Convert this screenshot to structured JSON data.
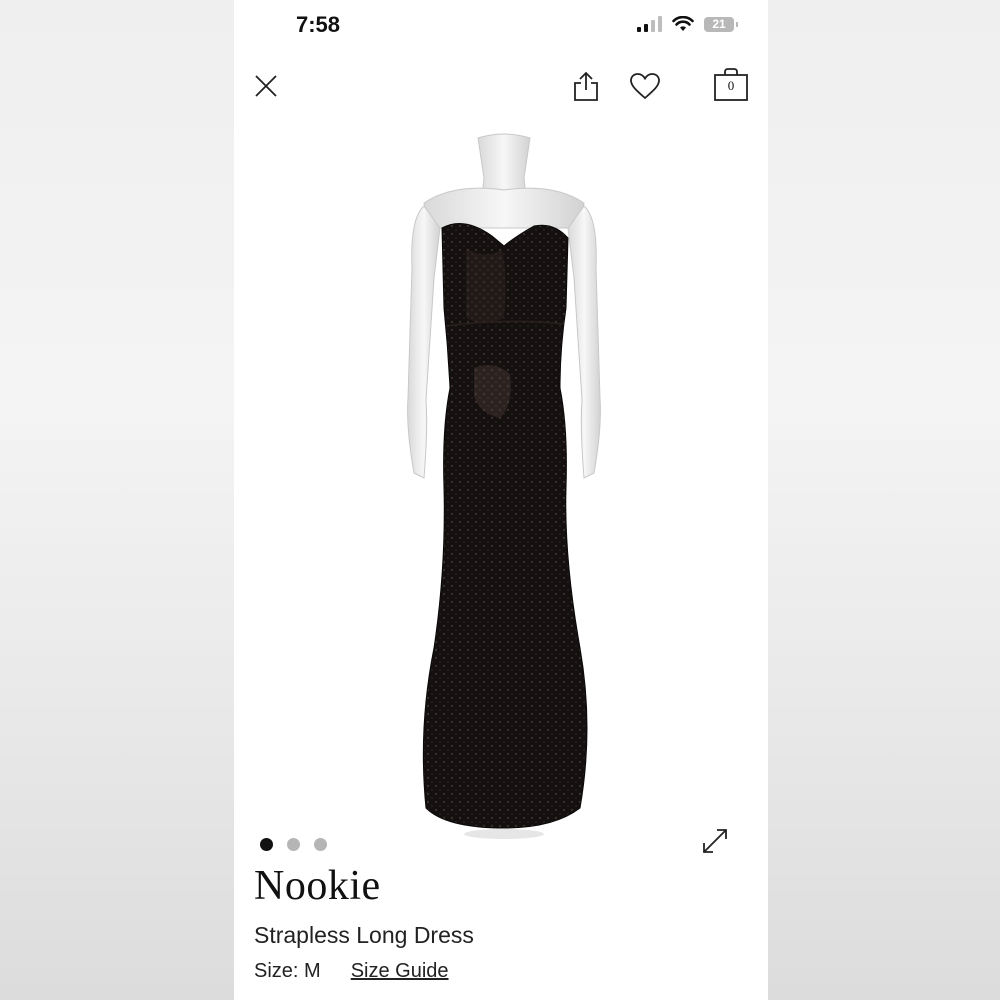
{
  "status_bar": {
    "time": "7:58",
    "battery_level": "21"
  },
  "nav": {
    "close_icon": "close-icon",
    "share_icon": "share-icon",
    "favorite_icon": "heart-icon",
    "bag_icon": "shopping-bag-icon",
    "bag_count": "0"
  },
  "carousel": {
    "total": 3,
    "active_index": 0,
    "expand_icon": "expand-icon"
  },
  "product": {
    "brand": "Nookie",
    "name": "Strapless Long Dress",
    "size_text": "Size: M",
    "size_guide_label": "Size Guide",
    "image_description_icon": "product-photo"
  }
}
